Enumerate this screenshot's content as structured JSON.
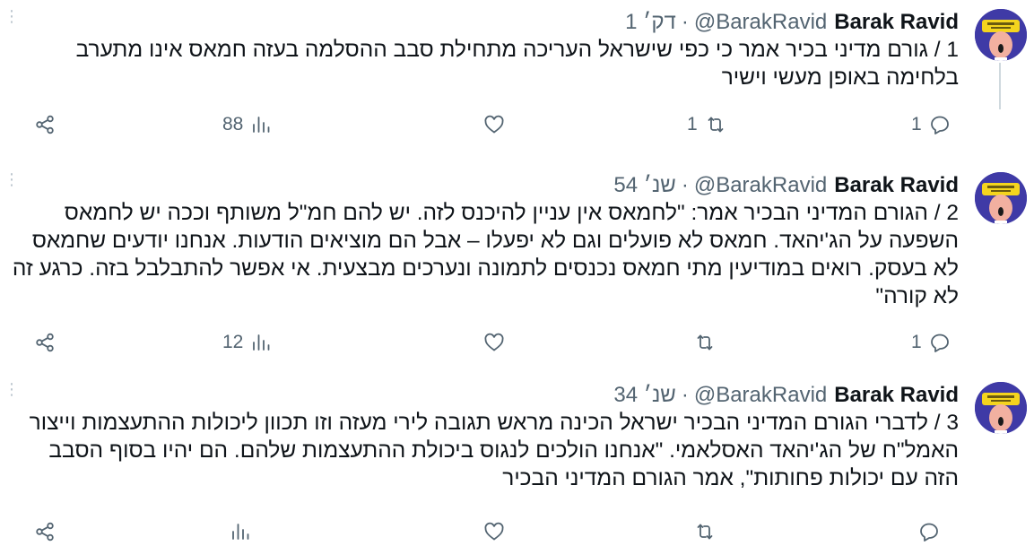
{
  "author": {
    "name": "Barak Ravid",
    "handle": "@BarakRavid",
    "separator": "·"
  },
  "tweets": [
    {
      "time": "1 דק׳",
      "text": "1 / גורם מדיני בכיר אמר כי כפי שישראל העריכה מתחילת סבב ההסלמה בעזה חמאס אינו מתערב בלחימה באופן מעשי וישיר",
      "replies": "1",
      "retweets": "1",
      "likes": "",
      "views": "88"
    },
    {
      "time": "54 שנ׳",
      "text": "2 / הגורם המדיני הבכיר אמר: \"לחמאס אין עניין להיכנס לזה. יש להם חמ\"ל משותף וככה יש לחמאס השפעה על הג'יהאד. חמאס לא פועלים וגם לא יפעלו – אבל הם מוציאים הודעות. אנחנו יודעים שחמאס לא בעסק. רואים במודיעין מתי חמאס נכנסים לתמונה ונערכים מבצעית. אי אפשר להתבלבל בזה. כרגע זה לא קורה\"",
      "replies": "1",
      "retweets": "",
      "likes": "",
      "views": "12"
    },
    {
      "time": "34 שנ׳",
      "text": "3 / לדברי הגורם המדיני הבכיר ישראל הכינה מראש תגובה לירי מעזה וזו תכוון ליכולות ההתעצמות וייצור האמל\"ח של הג'יהאד האסלאמי. \"אנחנו הולכים לנגוס ביכולת ההתעצמות שלהם. הם יהיו בסוף הסבב הזה עם יכולות פחותות\", אמר הגורם המדיני הבכיר",
      "replies": "",
      "retweets": "",
      "likes": "",
      "views": ""
    }
  ],
  "icons": {
    "reply": "reply-icon",
    "retweet": "retweet-icon",
    "like": "heart-icon",
    "views": "views-icon",
    "share": "share-icon",
    "more": "more-icon"
  },
  "colors": {
    "text": "#0f1419",
    "muted": "#536471",
    "thread_line": "#cfd9de"
  }
}
